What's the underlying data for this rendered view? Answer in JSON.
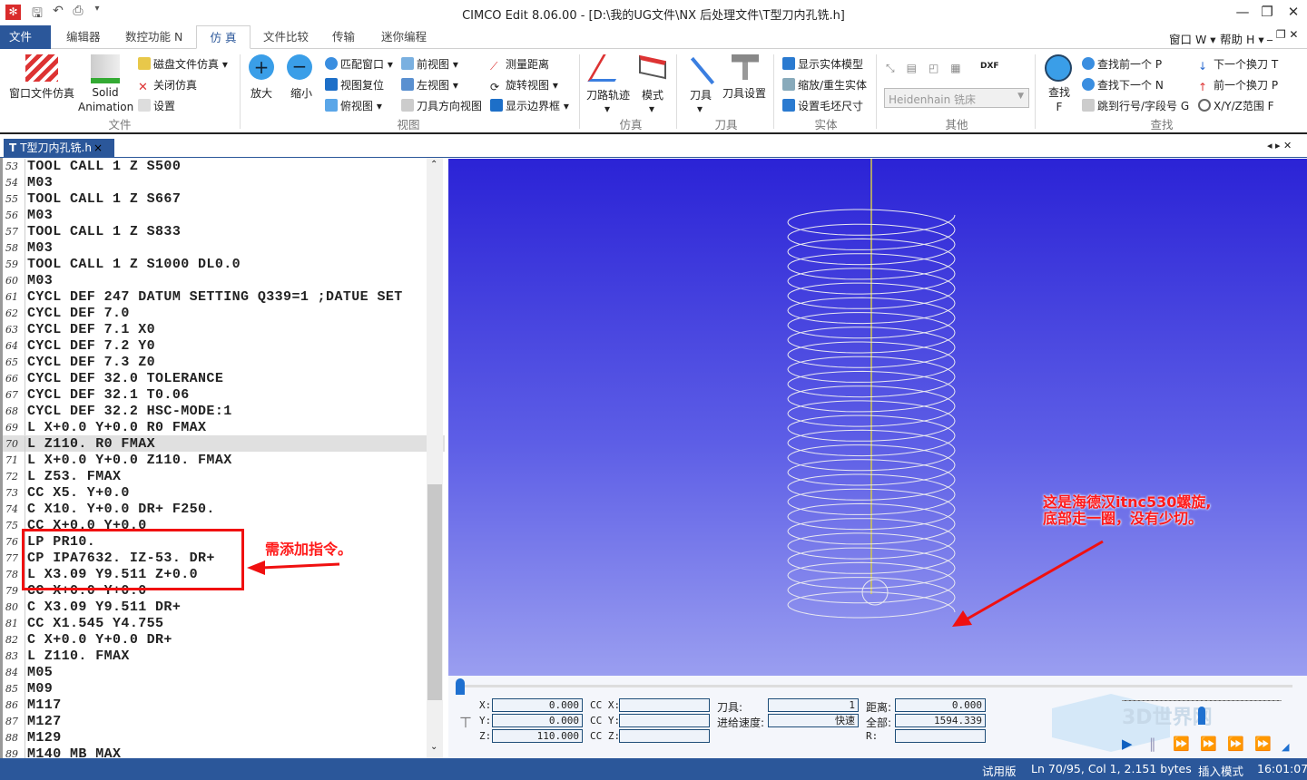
{
  "window": {
    "title": "CIMCO Edit 8.06.00 - [D:\\我的UG文件\\NX 后处理文件\\T型刀内孔铣.h]",
    "minimize": "—",
    "restore": "❐",
    "close": "✕"
  },
  "quick_access": [
    "save-icon",
    "undo-icon",
    "print-icon",
    "customize-icon"
  ],
  "menu": {
    "tabs": [
      "文件 F",
      "编辑器",
      "数控功能 N",
      "仿 真",
      "文件比较",
      "传输",
      "迷你编程"
    ],
    "active": "仿 真",
    "right": [
      "窗口 W ▾",
      "帮助 H ▾"
    ]
  },
  "ribbon": {
    "file_group": {
      "label": "文件",
      "window_sim": "窗口文件仿真",
      "solid_anim": "Solid Animation",
      "disk_sim": "磁盘文件仿真",
      "close_sim": "关闭仿真",
      "settings": "设置"
    },
    "view_group": {
      "label": "视图",
      "zoom_in": "放大",
      "zoom_out": "缩小",
      "fit": "匹配窗口",
      "reset": "视图复位",
      "top": "俯视图",
      "front": "前视图",
      "left": "左视图",
      "tool_dir": "刀具方向视图",
      "measure": "测量距离",
      "rotate": "旋转视图",
      "bounds": "显示边界框"
    },
    "sim_group": {
      "label": "仿真",
      "toolpath": "刀路轨迹",
      "mode": "模式"
    },
    "tool_group": {
      "label": "刀具",
      "tool": "刀具",
      "tool_setup": "刀具设置"
    },
    "solid_group": {
      "label": "实体",
      "show_solid": "显示实体模型",
      "zoom_regen": "缩放/重生实体",
      "stock": "设置毛坯尺寸"
    },
    "other_group": {
      "label": "其他",
      "machine": "Heidenhain 铣床",
      "dxf": "DXF"
    },
    "find_group": {
      "label": "查找",
      "find": "查找",
      "find_key": "F",
      "prev": "查找前一个 P",
      "next": "查找下一个 N",
      "goto": "跳到行号/字段号 G",
      "next_tool": "下一个换刀 T",
      "prev_tool": "前一个换刀 P",
      "xyz": "X/Y/Z范围 F"
    }
  },
  "doc_tab": {
    "label": "T型刀内孔铣.h",
    "close": "×"
  },
  "editor": {
    "current_line": 70,
    "lines": [
      [
        "53",
        "TOOL CALL 1 Z S500"
      ],
      [
        "54",
        "M03"
      ],
      [
        "55",
        "TOOL CALL 1 Z S667"
      ],
      [
        "56",
        "M03"
      ],
      [
        "57",
        "TOOL CALL 1 Z S833"
      ],
      [
        "58",
        "M03"
      ],
      [
        "59",
        "TOOL CALL 1 Z S1000 DL0.0"
      ],
      [
        "60",
        "M03"
      ],
      [
        "61",
        "CYCL DEF 247 DATUM SETTING Q339=1 ;DATUE SET"
      ],
      [
        "62",
        "CYCL DEF 7.0"
      ],
      [
        "63",
        "CYCL DEF 7.1 X0"
      ],
      [
        "64",
        "CYCL DEF 7.2 Y0"
      ],
      [
        "65",
        "CYCL DEF 7.3 Z0"
      ],
      [
        "66",
        "CYCL DEF 32.0 TOLERANCE"
      ],
      [
        "67",
        "CYCL DEF 32.1 T0.06"
      ],
      [
        "68",
        "CYCL DEF 32.2 HSC-MODE:1"
      ],
      [
        "69",
        "L X+0.0 Y+0.0 R0 FMAX"
      ],
      [
        "70",
        "L Z110. R0 FMAX"
      ],
      [
        "71",
        "L X+0.0 Y+0.0 Z110. FMAX"
      ],
      [
        "72",
        "L Z53. FMAX"
      ],
      [
        "73",
        "CC X5. Y+0.0"
      ],
      [
        "74",
        "C X10. Y+0.0 DR+ F250."
      ],
      [
        "75",
        "CC X+0.0 Y+0.0"
      ],
      [
        "76",
        "LP PR10."
      ],
      [
        "77",
        "CP IPA7632. IZ-53. DR+"
      ],
      [
        "78",
        "L X3.09 Y9.511 Z+0.0"
      ],
      [
        "79",
        "CC X+0.0 Y+0.0"
      ],
      [
        "80",
        "C X3.09 Y9.511 DR+"
      ],
      [
        "81",
        "CC X1.545 Y4.755"
      ],
      [
        "82",
        "C X+0.0 Y+0.0 DR+"
      ],
      [
        "83",
        "L Z110. FMAX"
      ],
      [
        "84",
        "M05"
      ],
      [
        "85",
        "M09"
      ],
      [
        "86",
        "M117"
      ],
      [
        "87",
        "M127"
      ],
      [
        "88",
        "M129"
      ],
      [
        "89",
        "M140 MB MAX"
      ]
    ]
  },
  "annotations": {
    "left_note": "需添加指令。",
    "right_note_1": "这是海德汉itnc530螺旋,",
    "right_note_2": "底部走一圈，没有少切。",
    "color": "#ff1a1a"
  },
  "sim_panel": {
    "x_label": "X:",
    "x": "0.000",
    "y_label": "Y:",
    "y": "0.000",
    "z_label": "Z:",
    "z": "110.000",
    "ccx_label": "CC X:",
    "ccx": "",
    "ccy_label": "CC Y:",
    "ccy": "",
    "ccz_label": "CC Z:",
    "ccz": "",
    "tool_label": "刀具:",
    "tool": "1",
    "feed_label": "进给速度:",
    "feed": "快速",
    "dist_label": "距离:",
    "dist": "0.000",
    "total_label": "全部:",
    "total": "1594.339",
    "r_label": "R:",
    "r": "",
    "progress": 0.0,
    "controls": [
      "play-icon",
      "pause-icon",
      "step-icon",
      "step-move-icon",
      "step-z-icon",
      "step-tool-icon"
    ],
    "watermark": "3D世界网"
  },
  "status": {
    "mode": "试用版",
    "position": "Ln 70/95, Col 1, 2.151 bytes",
    "insert": "插入模式",
    "time": "16:01:07"
  },
  "colors": {
    "accent": "#2b579a",
    "viewport_top": "#2b23d6",
    "viewport_bottom": "#9a9ef0",
    "helix": "#e8e8f0",
    "spindle": "#d4c84a"
  }
}
